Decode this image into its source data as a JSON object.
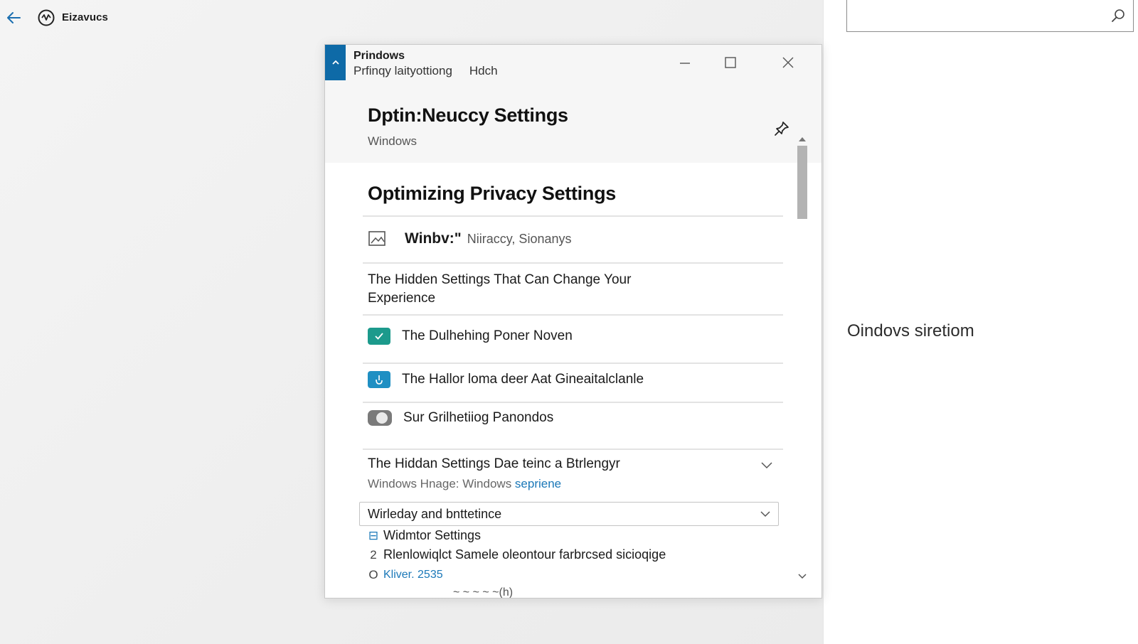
{
  "window": {
    "app_name": "Eizavucs",
    "title": "Prindows",
    "menu": [
      "Prfinqy laityottiong",
      "Hdch"
    ]
  },
  "header": {
    "title": "Dptin:Neuccy Settings",
    "subtitle": "Windows"
  },
  "main": {
    "title": "Optimizing Privacy Settings",
    "lead_bold": "Winbv:\"",
    "lead_text": "Niiraccy, Sionanys",
    "paragraph": "The Hidden Settings That Can Change Your Experience",
    "items": [
      {
        "label": "The Dulhehing Poner Noven",
        "icon": "check-icon"
      },
      {
        "label": "The Hallor loma deer Aat Gineaitalclanle",
        "icon": "hand-icon"
      },
      {
        "label": "Sur Grilhetiiog Panondos",
        "icon": "toggle-icon"
      }
    ],
    "expander": {
      "title": "The Hiddan Settings Dae teinc a Btrlengyr",
      "subtitle_prefix": "Windows Hnage: Windows ",
      "subtitle_link": "sepriene"
    },
    "select": {
      "value": "Wirleday and bnttetince"
    },
    "list": [
      {
        "mark": "⊟",
        "text": "Widmtor Settings"
      },
      {
        "mark": "2",
        "text": "Rlenlowiqlct Samele oleontour farbrcsed sicioqige"
      },
      {
        "mark": "O",
        "text": "Kliver. 2535"
      }
    ],
    "cut_text": "~ ~ ~ ~ ~(h)"
  },
  "right_pane": {
    "search": {
      "placeholder": ""
    },
    "text": "Oindovs siretiom"
  },
  "colors": {
    "accent": "#0e6aa7",
    "teal": "#1c9a8c",
    "blue": "#1f8fc3",
    "link": "#1b78b8"
  }
}
